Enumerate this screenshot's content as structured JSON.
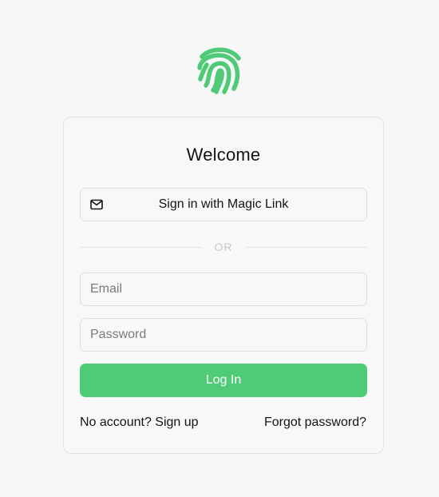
{
  "brand": {
    "logo_icon": "fingerprint-icon",
    "accent_color": "#4fca76"
  },
  "card": {
    "title": "Welcome",
    "magic_link": {
      "icon": "mail-icon",
      "label": "Sign in with Magic Link"
    },
    "divider_text": "OR",
    "email": {
      "placeholder": "Email",
      "value": ""
    },
    "password": {
      "placeholder": "Password",
      "value": ""
    },
    "login_label": "Log In",
    "signup_link": "No account? Sign up",
    "forgot_link": "Forgot password?"
  }
}
